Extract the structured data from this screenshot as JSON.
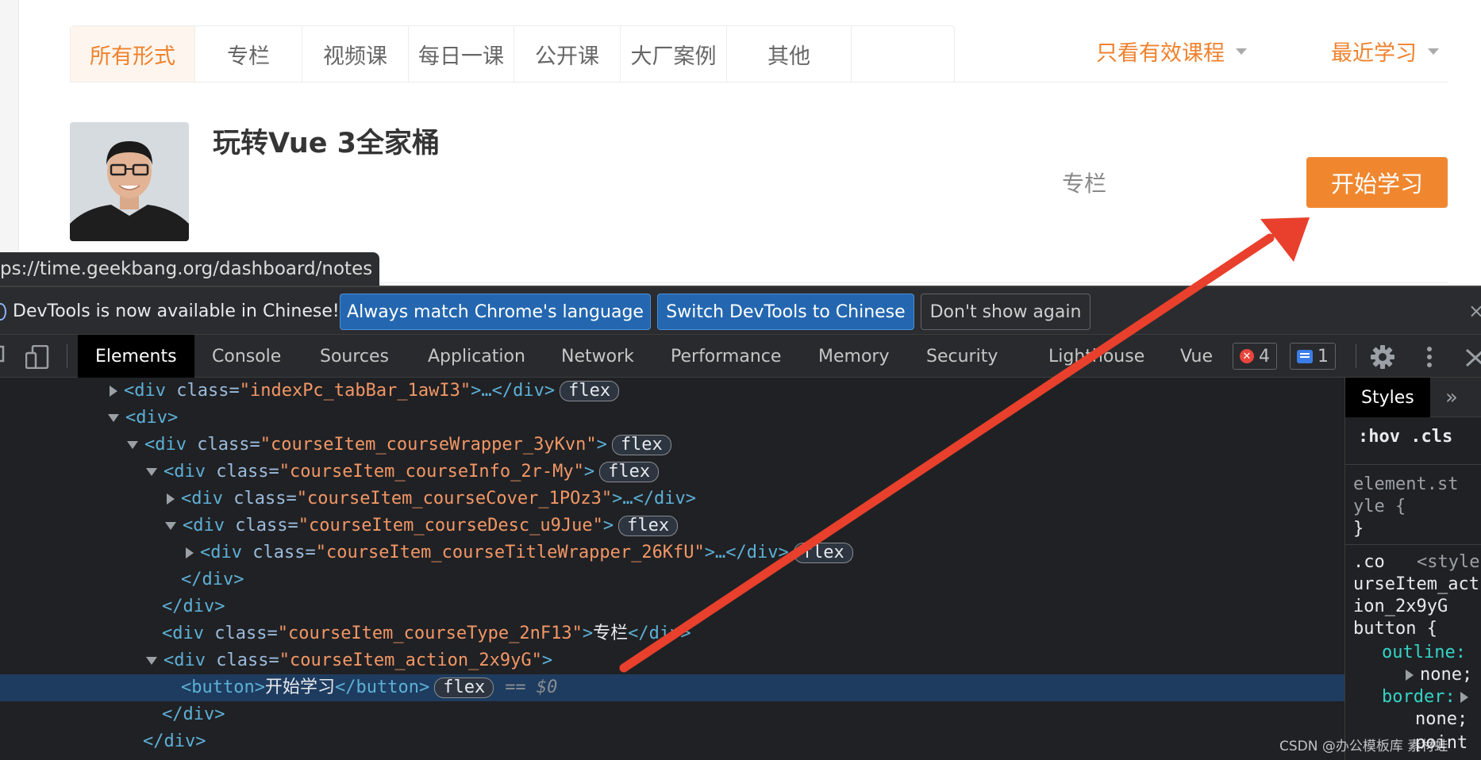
{
  "page": {
    "tabs": [
      "所有形式",
      "专栏",
      "视频课",
      "每日一课",
      "公开课",
      "大厂案例",
      "其他"
    ],
    "filters": [
      "只看有效课程",
      "最近学习"
    ],
    "course": {
      "title": "玩转Vue 3全家桶",
      "type": "专栏",
      "action_label": "开始学习"
    },
    "status_url": "ps://time.geekbang.org/dashboard/notes"
  },
  "devtools": {
    "infobar": {
      "message": "DevTools is now available in Chinese!",
      "buttons": [
        "Always match Chrome's language",
        "Switch DevTools to Chinese",
        "Don't show again"
      ],
      "close": "×"
    },
    "tabs": [
      "Elements",
      "Console",
      "Sources",
      "Application",
      "Network",
      "Performance",
      "Memory",
      "Security",
      "Lighthouse",
      "Vue"
    ],
    "error_count": "4",
    "message_count": "1",
    "dom_lines": {
      "l0": {
        "open": "<div ",
        "attr": "class=",
        "val": "\"indexPc_tabBar_1awI3\"",
        "close": ">…</div>",
        "pill": "flex"
      },
      "l1": {
        "open": "<div>"
      },
      "l2": {
        "open": "<div ",
        "attr": "class=",
        "val": "\"courseItem_courseWrapper_3yKvn\"",
        "close": ">",
        "pill": "flex"
      },
      "l3": {
        "open": "<div ",
        "attr": "class=",
        "val": "\"courseItem_courseInfo_2r-My\"",
        "close": ">",
        "pill": "flex"
      },
      "l4": {
        "open": "<div ",
        "attr": "class=",
        "val": "\"courseItem_courseCover_1POz3\"",
        "close": ">…</div>"
      },
      "l5": {
        "open": "<div ",
        "attr": "class=",
        "val": "\"courseItem_courseDesc_u9Jue\"",
        "close": ">",
        "pill": "flex"
      },
      "l6": {
        "open": "<div ",
        "attr": "class=",
        "val": "\"courseItem_courseTitleWrapper_26KfU\"",
        "close": ">…</div>",
        "pill": "flex"
      },
      "l7": {
        "open": "</div>"
      },
      "l8": {
        "open": "</div>"
      },
      "l9": {
        "open": "<div ",
        "attr": "class=",
        "val": "\"courseItem_courseType_2nF13\"",
        "close": ">",
        "text": "专栏",
        "end": "</div>"
      },
      "l10": {
        "open": "<div ",
        "attr": "class=",
        "val": "\"courseItem_action_2x9yG\"",
        "close": ">"
      },
      "l11": {
        "open": "<button>",
        "text": "开始学习",
        "end": "</button>",
        "pill": "flex",
        "eq": "== $0"
      },
      "l12": {
        "open": "</div>"
      },
      "l13": {
        "open": "</div>"
      }
    },
    "styles": {
      "tab": "Styles",
      "more": "»",
      "filter": ":hov .cls",
      "element_style": [
        "element.st",
        "yle {",
        "}"
      ],
      "rule_selector": [
        ".co",
        "urseItem_act",
        "ion_2x9yG",
        "button {"
      ],
      "source": "<style",
      "props": [
        {
          "name": "outline:",
          "value": "none;"
        },
        {
          "name": "border:",
          "value": "none;"
        }
      ],
      "overflow_text": "point"
    }
  },
  "watermark": "CSDN @办公模板库 素材蛙",
  "colors": {
    "accent": "#f0822e",
    "button": "#f0872f",
    "annotation_arrow": "#e8402c"
  }
}
